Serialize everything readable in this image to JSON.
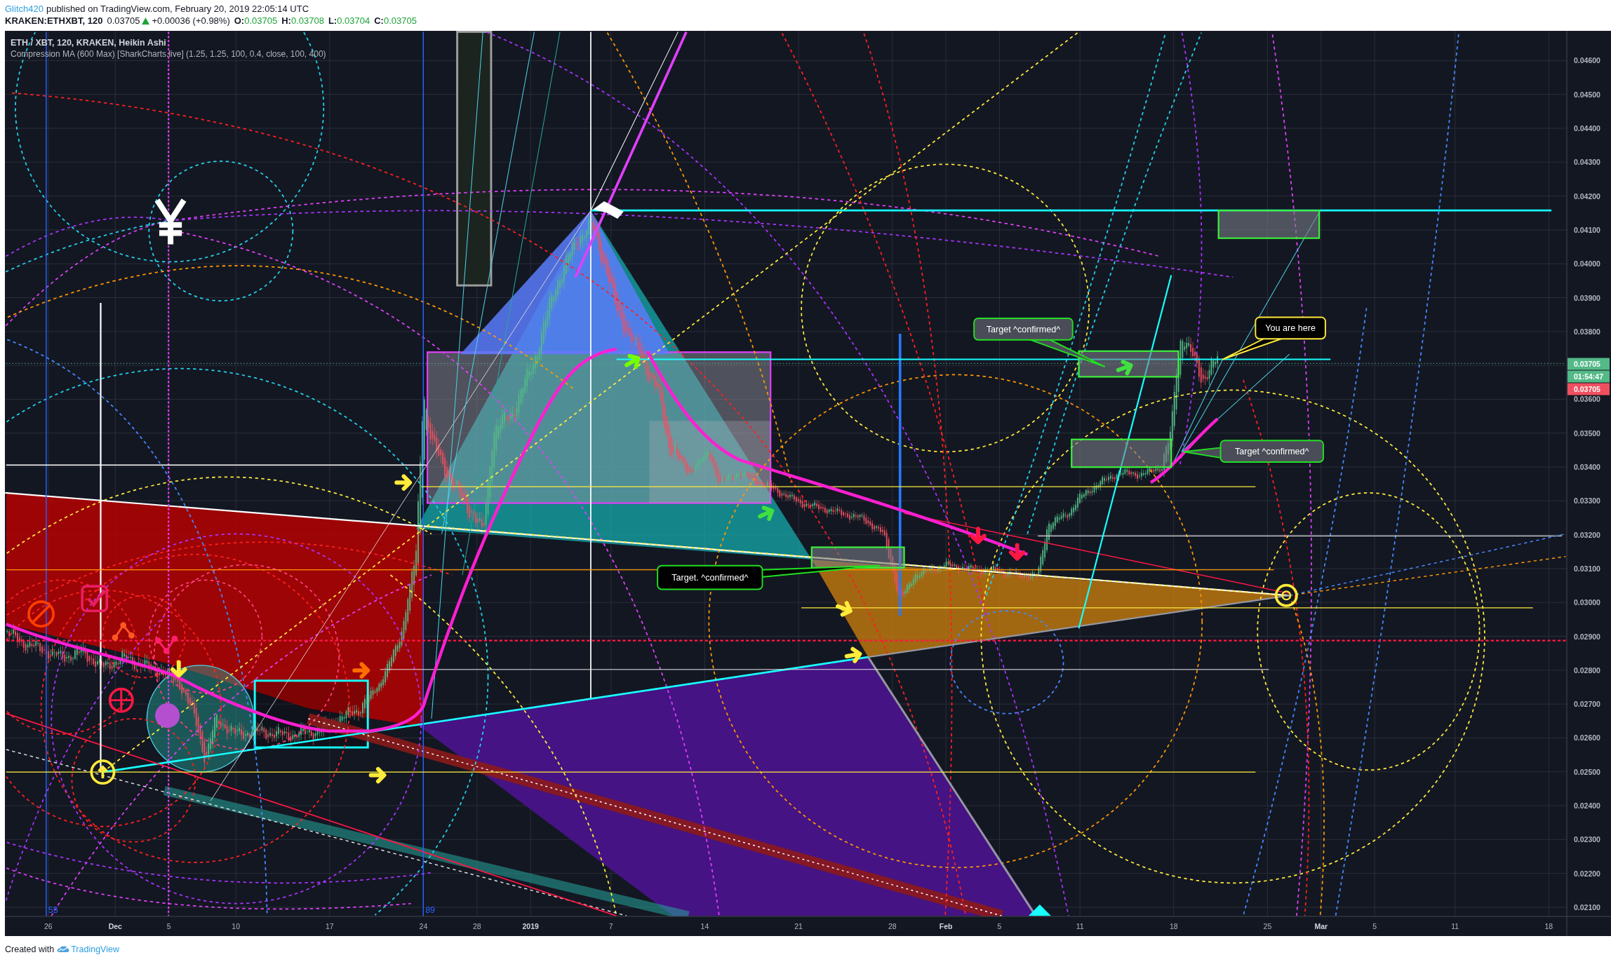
{
  "header": {
    "author": "Glitch420",
    "published": "published on TradingView.com, February 20, 2019 22:05:14 UTC"
  },
  "quote": {
    "symbol": "KRAKEN:ETHXBT, 120",
    "last": "0.03705",
    "change_up": true,
    "change": "+0.00036 (+0.98%)",
    "ohlc": [
      {
        "label": "O:",
        "value": "0.03705"
      },
      {
        "label": "H:",
        "value": "0.03708"
      },
      {
        "label": "L:",
        "value": "0.03704"
      },
      {
        "label": "C:",
        "value": "0.03705"
      }
    ]
  },
  "legend": {
    "series": "ETH / XBT, 120, KRAKEN, Heikin Ashi",
    "indicator": "Compression MA (600 Max) [SharkCharts.live] (1.25, 1.25, 100, 0.4, close, 100, 400)"
  },
  "annotations": [
    {
      "text": "Target ^confirmed^",
      "kind": "note",
      "color": "#22e022"
    },
    {
      "text": "You are here",
      "kind": "callout",
      "color": "#ffeb3b"
    },
    {
      "text": "Target ^confirmed^",
      "kind": "note",
      "color": "#22e022"
    },
    {
      "text": "Target. ^confirmed^",
      "kind": "callout",
      "color": "#22e022"
    }
  ],
  "time_zone_labels": [
    "55",
    "89"
  ],
  "price_axis": {
    "labels": [
      "0.04600",
      "0.04500",
      "0.04400",
      "0.04300",
      "0.04200",
      "0.04100",
      "0.04000",
      "0.03900",
      "0.03800",
      "0.03600",
      "0.03500",
      "0.03400",
      "0.03300",
      "0.03200",
      "0.03100",
      "0.03000",
      "0.02900",
      "0.02800",
      "0.02700",
      "0.02600",
      "0.02500",
      "0.02400",
      "0.02300",
      "0.02200",
      "0.02100"
    ],
    "tags": [
      {
        "text": "0.03705",
        "color": "#53b987"
      },
      {
        "text": "01:54:47",
        "color": "#53b987"
      },
      {
        "text": "0.03705",
        "color": "#ef5060"
      }
    ]
  },
  "time_axis": {
    "labels": [
      {
        "text": "26",
        "major": false
      },
      {
        "text": "Dec",
        "major": true
      },
      {
        "text": "5",
        "major": false
      },
      {
        "text": "10",
        "major": false
      },
      {
        "text": "17",
        "major": false
      },
      {
        "text": "24",
        "major": false
      },
      {
        "text": "28",
        "major": false
      },
      {
        "text": "2019",
        "major": true
      },
      {
        "text": "7",
        "major": false
      },
      {
        "text": "14",
        "major": false
      },
      {
        "text": "21",
        "major": false
      },
      {
        "text": "28",
        "major": false
      },
      {
        "text": "Feb",
        "major": true
      },
      {
        "text": "5",
        "major": false
      },
      {
        "text": "11",
        "major": false
      },
      {
        "text": "18",
        "major": false
      },
      {
        "text": "25",
        "major": false
      },
      {
        "text": "Mar",
        "major": true
      },
      {
        "text": "5",
        "major": false
      },
      {
        "text": "11",
        "major": false
      },
      {
        "text": "18",
        "major": false
      }
    ]
  },
  "footer": {
    "text": "Created with",
    "brand": "TradingView"
  }
}
